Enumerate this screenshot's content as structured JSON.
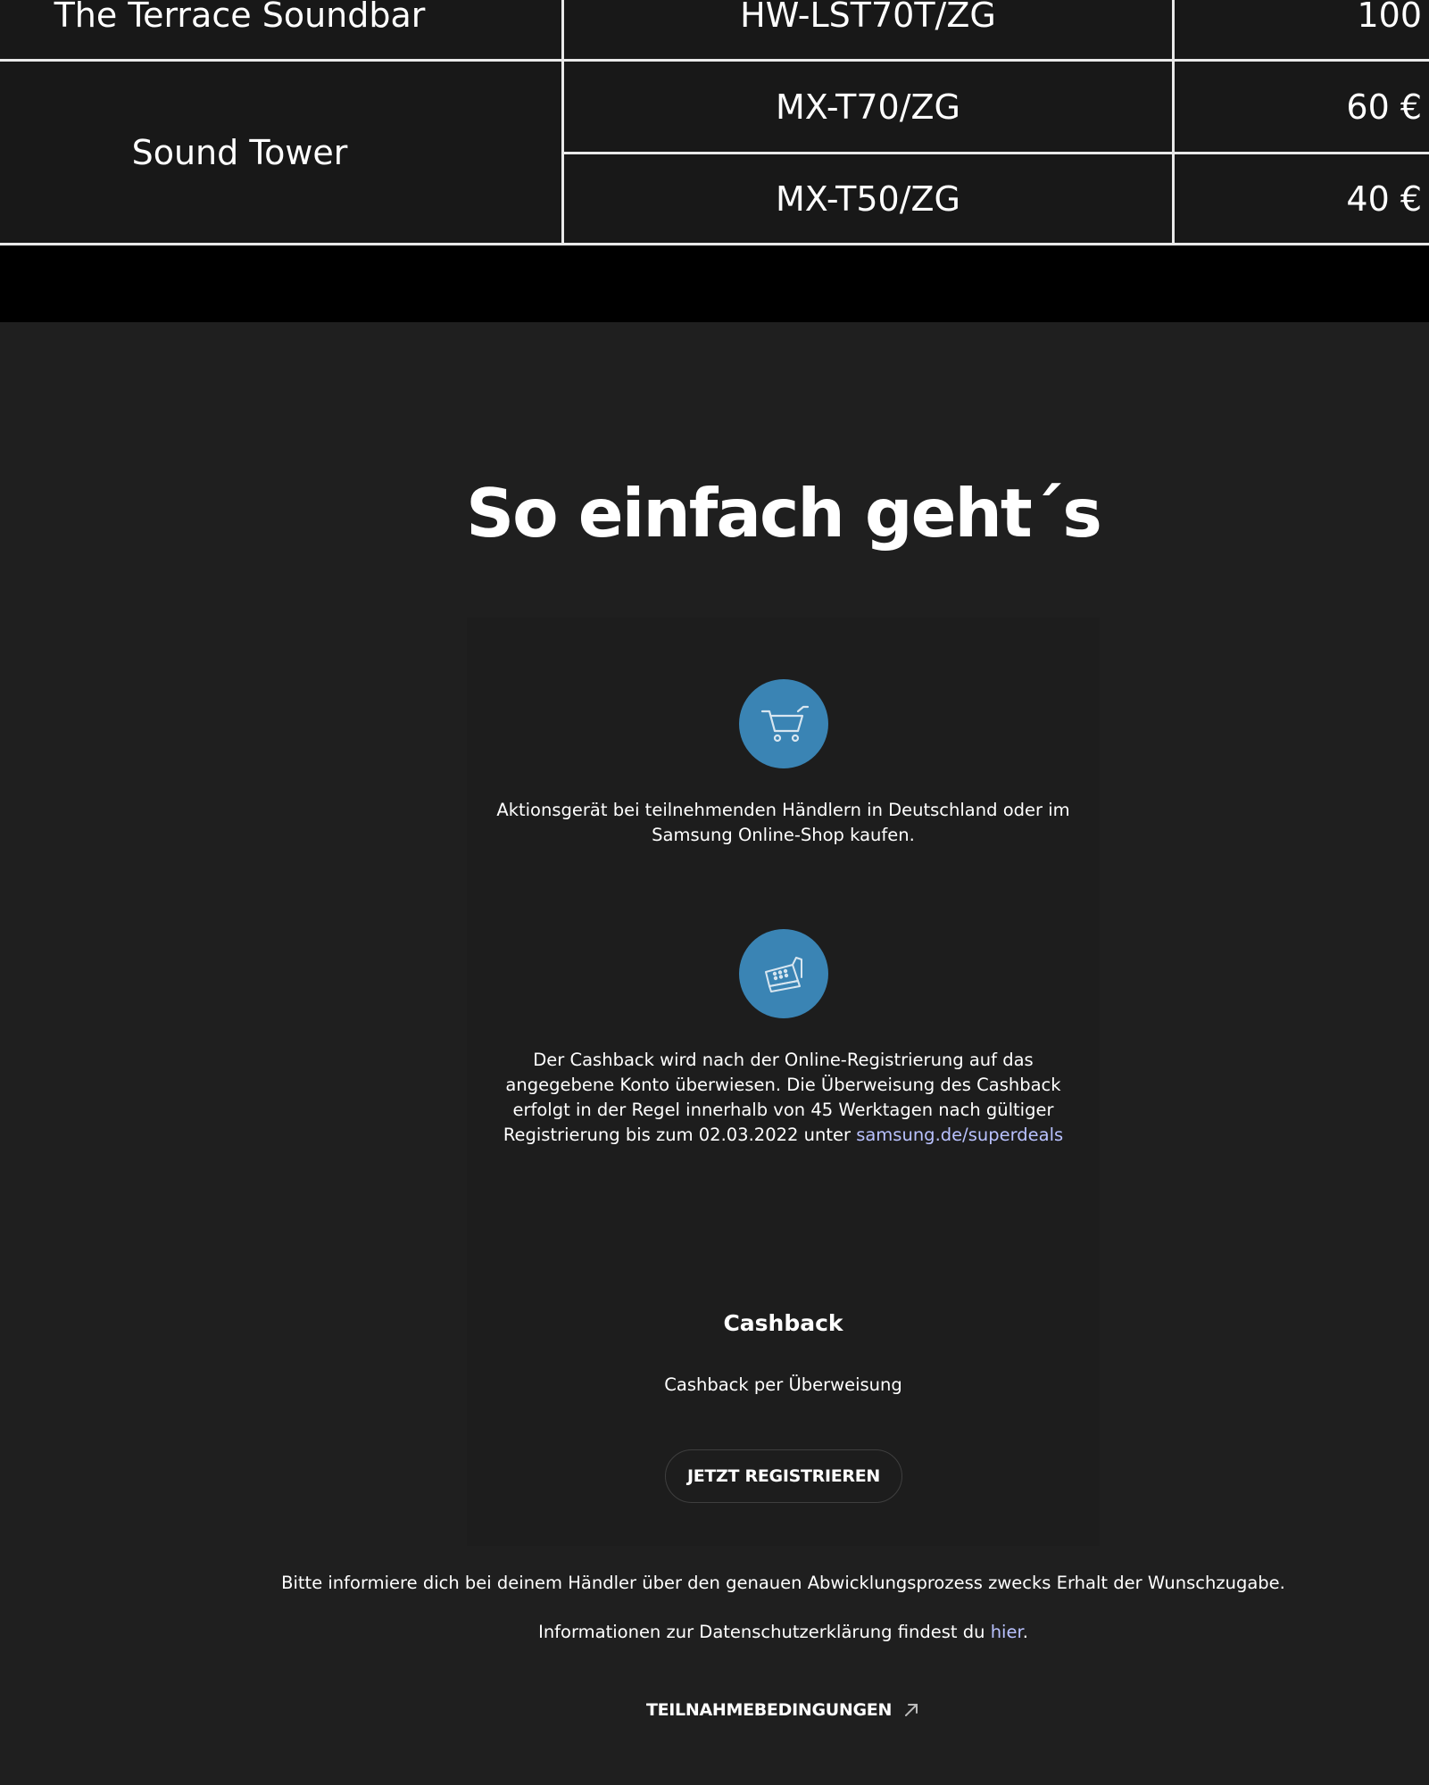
{
  "product_table": {
    "rows": [
      {
        "product": "The Terrace Soundbar",
        "model": "HW-LST70T/ZG",
        "cashback": "100"
      },
      {
        "product": "Sound Tower",
        "model": "MX-T70/ZG",
        "cashback": "60 €"
      },
      {
        "product": "",
        "model": "MX-T50/ZG",
        "cashback": "40 €"
      }
    ]
  },
  "how_it_works": {
    "title": "So einfach geht´s",
    "steps": [
      {
        "icon": "shopping-cart-icon",
        "text": "Aktionsgerät bei teilnehmenden Händlern in Deutschland oder im Samsung Online-Shop kaufen."
      },
      {
        "icon": "cash-register-icon",
        "text": "Der Cashback wird nach der Online-Registrierung auf das angegebene Konto überwiesen. Die Überweisung des Cashback erfolgt in der Regel innerhalb von 45 Werktagen nach gültiger Registrierung bis zum 02.03.2022 unter",
        "link_text": "samsung.de/superdeals"
      }
    ],
    "cashback": {
      "title": "Cashback",
      "subtitle": "Cashback per Überweisung",
      "button_label": "JETZT REGISTRIEREN"
    },
    "notice": "Bitte informiere dich bei deinem Händler über den genauen Abwicklungsprozess zwecks Erhalt der Wunschzugabe.",
    "privacy": {
      "text": "Informationen zur Datenschutzerklärung findest du",
      "link_text": "hier",
      "suffix": "."
    },
    "terms_label": "TEILNAHMEBEDINGUNGEN"
  },
  "colors": {
    "accent_circle": "#3a84b4",
    "link": "#b9c2ff",
    "background": "#1f1f1f"
  }
}
